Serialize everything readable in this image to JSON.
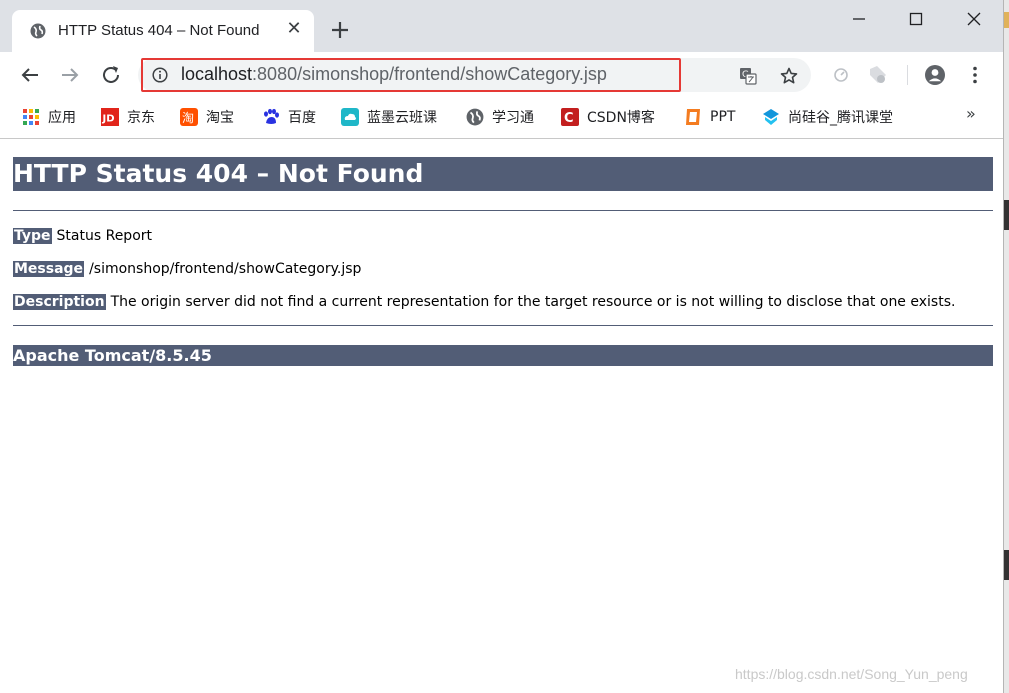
{
  "tab": {
    "title": "HTTP Status 404 – Not Found",
    "favicon": "globe-icon",
    "close": "✕"
  },
  "toolbar": {
    "url_host": "localhost",
    "url_rest": ":8080/simonshop/frontend/showCategory.jsp"
  },
  "bookmarks": [
    {
      "label": "应用",
      "icon": "apps-grid-icon",
      "color": "#e53935"
    },
    {
      "label": "京东",
      "icon": "jd-icon",
      "color": "#e1251b"
    },
    {
      "label": "淘宝",
      "icon": "taobao-icon",
      "color": "#ff5000"
    },
    {
      "label": "百度",
      "icon": "baidu-icon",
      "color": "#2932e1"
    },
    {
      "label": "蓝墨云班课",
      "icon": "cloud-icon",
      "color": "#1fb7c8"
    },
    {
      "label": "学习通",
      "icon": "globe-icon",
      "color": "#5f6368"
    },
    {
      "label": "CSDN博客",
      "icon": "csdn-icon",
      "color": "#c31f1f"
    },
    {
      "label": "PPT",
      "icon": "ppt-icon",
      "color": "#f47c20"
    },
    {
      "label": "尚硅谷_腾讯课堂",
      "icon": "tencent-classroom-icon",
      "color": "#1296db"
    }
  ],
  "bookmarks_more": "»",
  "page": {
    "title": "HTTP Status 404 – Not Found",
    "type_label": "Type",
    "type_value": "Status Report",
    "message_label": "Message",
    "message_value": "/simonshop/frontend/showCategory.jsp",
    "description_label": "Description",
    "description_value": "The origin server did not find a current representation for the target resource or is not willing to disclose that one exists.",
    "server": "Apache Tomcat/8.5.45"
  },
  "watermark": "https://blog.csdn.net/Song_Yun_peng",
  "colors": {
    "tomcat_header": "#525d76",
    "url_highlight": "#e53935",
    "tabstrip": "#dee1e6"
  }
}
